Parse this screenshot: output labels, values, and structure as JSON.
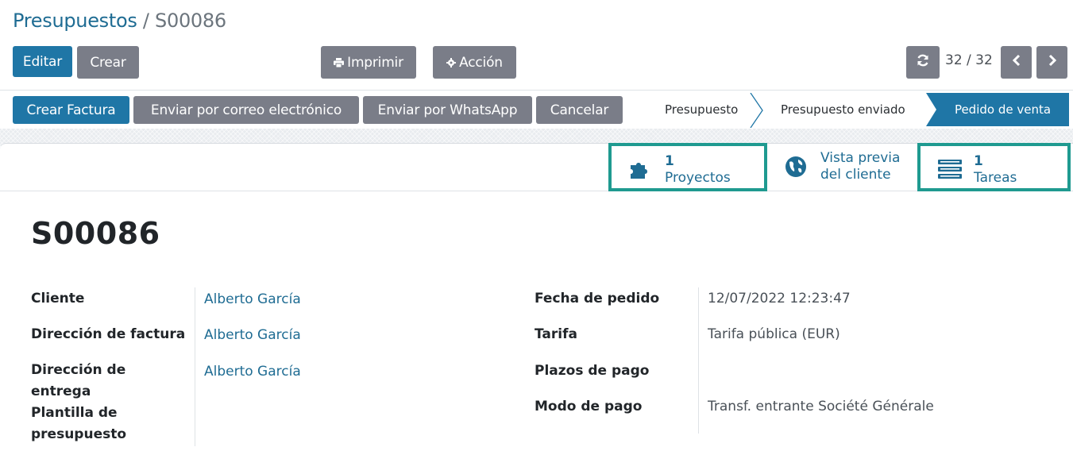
{
  "breadcrumb": {
    "parent": "Presupuestos",
    "separator": " / ",
    "current": "S00086"
  },
  "toolbar": {
    "edit_label": "Editar",
    "create_label": "Crear",
    "print_label": "Imprimir",
    "action_label": "Acción",
    "print_icon": "printer-icon",
    "action_icon": "gear-icon"
  },
  "pager": {
    "value": "32 / 32"
  },
  "statusbar": {
    "buttons": [
      "Crear Factura",
      "Enviar por correo electrónico",
      "Enviar por WhatsApp",
      "Cancelar"
    ],
    "stages": [
      "Presupuesto",
      "Presupuesto enviado",
      "Pedido de venta"
    ],
    "active_stage": "Pedido de venta"
  },
  "smart_buttons": [
    {
      "number": "1",
      "label": "Proyectos",
      "icon": "puzzle-icon",
      "highlighted": true
    },
    {
      "line1": "Vista previa",
      "line2": "del cliente",
      "icon": "globe-icon",
      "highlighted": false
    },
    {
      "number": "1",
      "label": "Tareas",
      "icon": "tasks-icon",
      "highlighted": true
    }
  ],
  "record": {
    "name": "S00086",
    "left_fields": [
      {
        "label": "Cliente",
        "value": "Alberto García"
      },
      {
        "label": "Dirección de factura",
        "value": "Alberto García"
      },
      {
        "label": "Dirección de entrega",
        "value": "Alberto García"
      },
      {
        "label": "Plantilla de presupuesto",
        "value": ""
      }
    ],
    "right_fields": [
      {
        "label": "Fecha de pedido",
        "value": "12/07/2022 12:23:47"
      },
      {
        "label": "Tarifa",
        "value": "Tarifa pública (EUR)"
      },
      {
        "label": "Plazos de pago",
        "value": ""
      },
      {
        "label": "Modo de pago",
        "value": "Transf. entrante Société Générale"
      }
    ]
  },
  "colors": {
    "primary": "#1f76a6",
    "secondary": "#7a7d88",
    "link": "#1f6c93",
    "highlight": "#1f9a90"
  }
}
